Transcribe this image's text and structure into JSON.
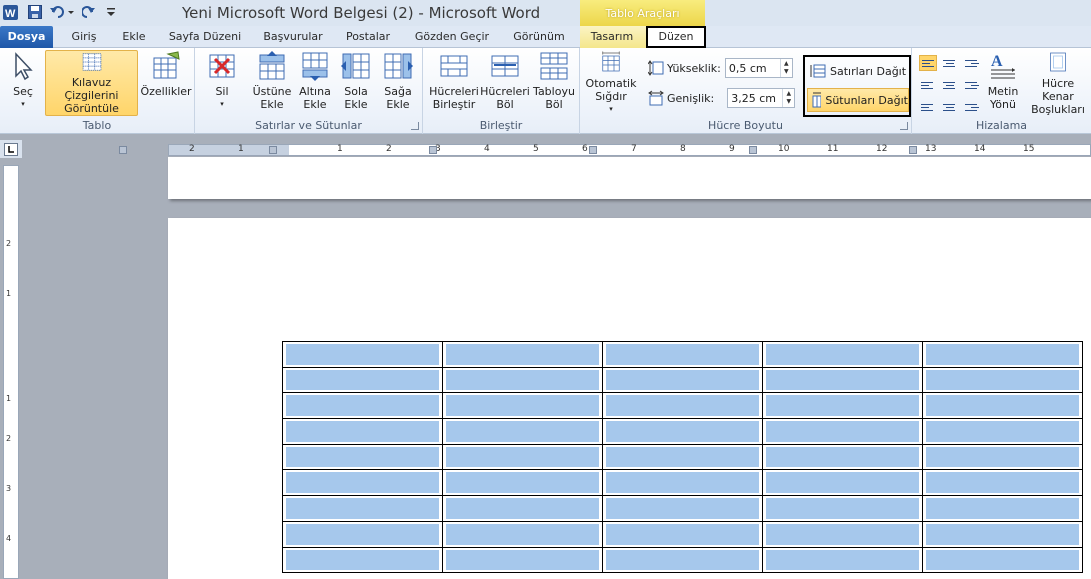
{
  "window": {
    "title": "Yeni Microsoft Word Belgesi (2)  -  Microsoft Word",
    "context_header": "Tablo Araçları"
  },
  "tabs": [
    "Dosya",
    "Giriş",
    "Ekle",
    "Sayfa Düzeni",
    "Başvurular",
    "Postalar",
    "Gözden Geçir",
    "Görünüm",
    "Tasarım",
    "Düzen"
  ],
  "ribbon": {
    "tablo": {
      "label": "Tablo",
      "sec": "Seç",
      "kilavuz": "Kılavuz Çizgilerini Görüntüle",
      "ozellikler": "Özellikler"
    },
    "satirlar": {
      "label": "Satırlar ve Sütunlar",
      "sil": "Sil",
      "ustune": "Üstüne Ekle",
      "altina": "Altına Ekle",
      "sola": "Sola Ekle",
      "saga": "Sağa Ekle"
    },
    "birlestir": {
      "label": "Birleştir",
      "hucreleri_birlestir": "Hücreleri Birleştir",
      "hucreleri_bol": "Hücreleri Böl",
      "tabloyu_bol": "Tabloyu Böl"
    },
    "hucre_boyutu": {
      "label": "Hücre Boyutu",
      "otomatik": "Otomatik Sığdır",
      "yukseklik_label": "Yükseklik:",
      "yukseklik_value": "0,5 cm",
      "genislik_label": "Genişlik:",
      "genislik_value": "3,25 cm",
      "satirlari_dagit": "Satırları Dağıt",
      "sutunlari_dagit": "Sütunları Dağıt"
    },
    "hizalama": {
      "label": "Hizalama",
      "metin_yonu": "Metin Yönü",
      "hucre_kenar": "Hücre Kenar Boşlukları"
    }
  },
  "hruler_numbers": [
    "2",
    "1",
    "1",
    "2",
    "3",
    "4",
    "5",
    "6",
    "7",
    "8",
    "9",
    "10",
    "11",
    "12",
    "13",
    "14",
    "15"
  ],
  "vruler_numbers": [
    "2",
    "1",
    "1",
    "2",
    "3",
    "4"
  ],
  "table": {
    "rows": 9,
    "cols": 5,
    "highlight_color": "#a6c8ec"
  }
}
